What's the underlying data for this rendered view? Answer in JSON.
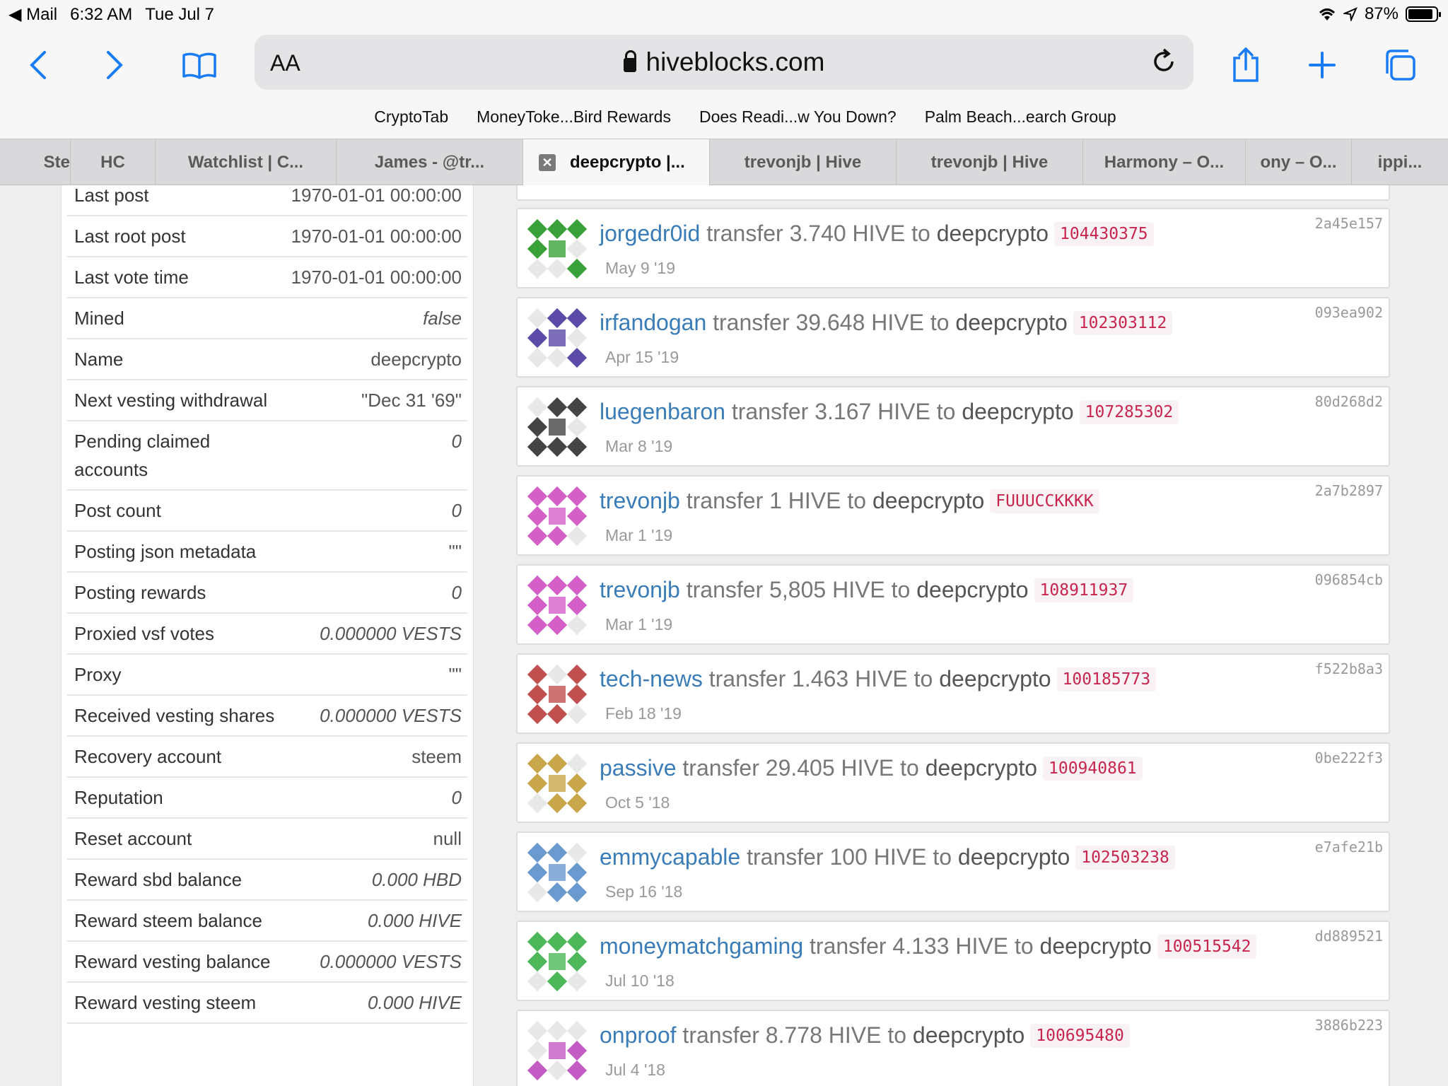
{
  "status": {
    "back_app": "Mail",
    "time": "6:32 AM",
    "date": "Tue Jul 7",
    "battery": "87%"
  },
  "toolbar": {
    "text_size": "AA",
    "host": "hiveblocks.com"
  },
  "bookmarks": [
    "CryptoTab",
    "MoneyToke...Bird Rewards",
    "Does Readi...w You Down?",
    "Palm Beach...earch Group"
  ],
  "tabs": [
    "Ste",
    "HC",
    "Watchlist | C...",
    "James - @tr...",
    "deepcrypto |...",
    "trevonjb | Hive",
    "trevonjb | Hive",
    "Harmony – O...",
    "ony – O...",
    "ippi..."
  ],
  "properties": [
    {
      "k": "Last post",
      "v": "1970-01-01 00:00:00"
    },
    {
      "k": "Last root post",
      "v": "1970-01-01 00:00:00"
    },
    {
      "k": "Last vote time",
      "v": "1970-01-01 00:00:00"
    },
    {
      "k": "Mined",
      "v": "false"
    },
    {
      "k": "Name",
      "v": "deepcrypto"
    },
    {
      "k": "Next vesting withdrawal",
      "v": "\"Dec 31 '69\""
    },
    {
      "k": "Pending claimed accounts",
      "v": "0"
    },
    {
      "k": "Post count",
      "v": "0"
    },
    {
      "k": "Posting json metadata",
      "v": "\"\""
    },
    {
      "k": "Posting rewards",
      "v": "0"
    },
    {
      "k": "Proxied vsf votes",
      "v": "0.000000 VESTS"
    },
    {
      "k": "Proxy",
      "v": "\"\""
    },
    {
      "k": "Received vesting shares",
      "v": "0.000000 VESTS"
    },
    {
      "k": "Recovery account",
      "v": "steem"
    },
    {
      "k": "Reputation",
      "v": "0"
    },
    {
      "k": "Reset account",
      "v": "null"
    },
    {
      "k": "Reward sbd balance",
      "v": "0.000 HBD"
    },
    {
      "k": "Reward steem balance",
      "v": "0.000 HIVE"
    },
    {
      "k": "Reward vesting balance",
      "v": "0.000000 VESTS"
    },
    {
      "k": "Reward vesting steem",
      "v": "0.000 HIVE"
    }
  ],
  "transfers": [
    {
      "from": "jorgedr0id",
      "text": "transfer 3.740 HIVE to",
      "to": "deepcrypto",
      "memo": "104430375",
      "date": "May 9 '19",
      "hash": "2a45e157",
      "color": "#3aa13a"
    },
    {
      "from": "irfandogan",
      "text": "transfer 39.648 HIVE to",
      "to": "deepcrypto",
      "memo": "102303112",
      "date": "Apr 15 '19",
      "hash": "093ea902",
      "color": "#5b4aa8"
    },
    {
      "from": "luegenbaron",
      "text": "transfer 3.167 HIVE to",
      "to": "deepcrypto",
      "memo": "107285302",
      "date": "Mar 8 '19",
      "hash": "80d268d2",
      "color": "#444444"
    },
    {
      "from": "trevonjb",
      "text": "transfer 1 HIVE to",
      "to": "deepcrypto",
      "memo": "FUUUCCKKKK",
      "date": "Mar 1 '19",
      "hash": "2a7b2897",
      "color": "#d45fc7"
    },
    {
      "from": "trevonjb",
      "text": "transfer 5,805 HIVE to",
      "to": "deepcrypto",
      "memo": "108911937",
      "date": "Mar 1 '19",
      "hash": "096854cb",
      "color": "#d45fc7"
    },
    {
      "from": "tech-news",
      "text": "transfer 1.463 HIVE to",
      "to": "deepcrypto",
      "memo": "100185773",
      "date": "Feb 18 '19",
      "hash": "f522b8a3",
      "color": "#c0504d"
    },
    {
      "from": "passive",
      "text": "transfer 29.405 HIVE to",
      "to": "deepcrypto",
      "memo": "100940861",
      "date": "Oct 5 '18",
      "hash": "0be222f3",
      "color": "#c9a64a"
    },
    {
      "from": "emmycapable",
      "text": "transfer 100 HIVE to",
      "to": "deepcrypto",
      "memo": "102503238",
      "date": "Sep 16 '18",
      "hash": "e7afe21b",
      "color": "#6a9ad0"
    },
    {
      "from": "moneymatchgaming",
      "text": "transfer 4.133 HIVE to",
      "to": "deepcrypto",
      "memo": "100515542",
      "date": "Jul 10 '18",
      "hash": "dd889521",
      "color": "#4cb85a"
    },
    {
      "from": "onproof",
      "text": "transfer 8.778 HIVE to",
      "to": "deepcrypto",
      "memo": "100695480",
      "date": "Jul 4 '18",
      "hash": "3886b223",
      "color": "#c45ac4"
    }
  ]
}
